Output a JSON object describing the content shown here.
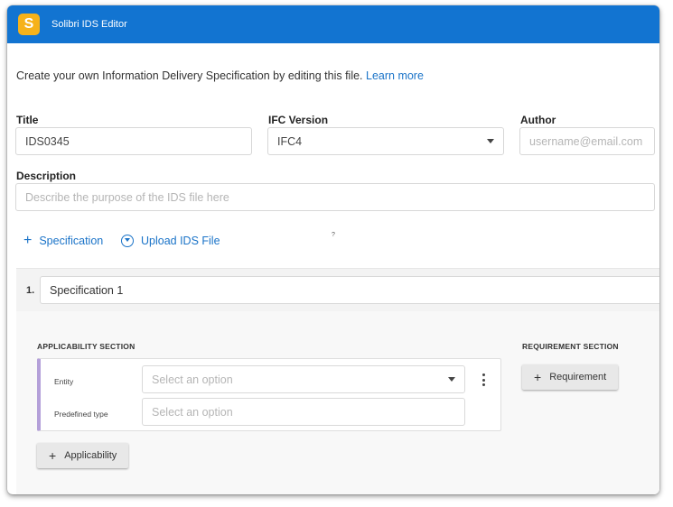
{
  "app": {
    "logo_letter": "S",
    "title": "Solibri IDS Editor"
  },
  "intro": {
    "text": "Create your own Information Delivery Specification by editing this file.",
    "link": "Learn more"
  },
  "form": {
    "title_label": "Title",
    "title_value": "IDS0345",
    "ifc_label": "IFC Version",
    "ifc_value": "IFC4",
    "author_label": "Author",
    "author_placeholder": "username@email.com",
    "description_label": "Description",
    "description_placeholder": "Describe the purpose of the IDS file here"
  },
  "actions": {
    "add_specification": "Specification",
    "upload_file": "Upload IDS File",
    "stray_mark": "?"
  },
  "specification": {
    "number": "1.",
    "name": "Specification 1",
    "applicability_title": "APPLICABILITY SECTION",
    "requirement_title": "REQUIREMENT SECTION",
    "entity_label": "Entity",
    "entity_placeholder": "Select an option",
    "predefined_label": "Predefined type",
    "predefined_placeholder": "Select an option",
    "add_requirement": "Requirement",
    "add_applicability": "Applicability"
  },
  "colors": {
    "titlebar": "#1274d1",
    "logo": "#f6b21a",
    "link": "#1a73c8",
    "facet_accent": "#b4a0d9"
  }
}
